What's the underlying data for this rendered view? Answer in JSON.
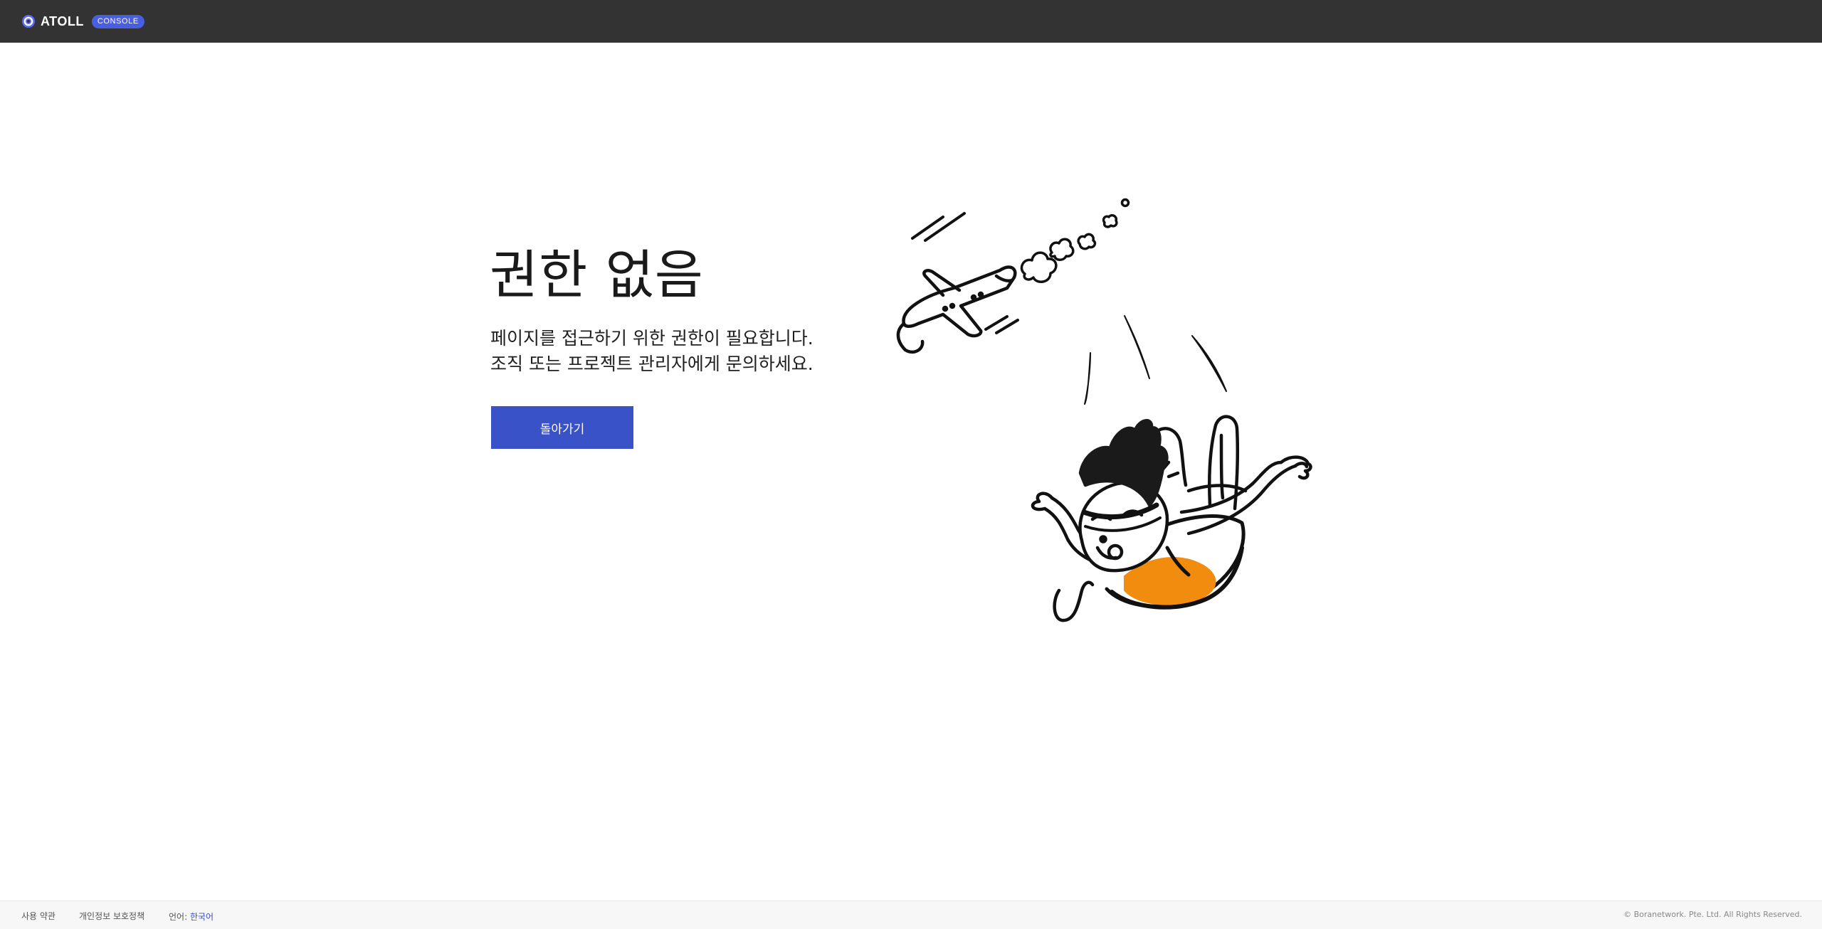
{
  "header": {
    "logo_text": "ATOLL",
    "badge": "CONSOLE",
    "brand_color": "#4a5fe0"
  },
  "main": {
    "title": "권한 없음",
    "description_line1": "페이지를 접근하기 위한 권한이 필요합니다.",
    "description_line2": "조직 또는 프로젝트 관리자에게 문의하세요.",
    "back_button_label": "돌아가기",
    "button_color": "#3a52c8",
    "illustration_accent": "#f18c0e"
  },
  "footer": {
    "terms_label": "사용 약관",
    "privacy_label": "개인정보 보호정책",
    "language_label": "언어:",
    "language_value": "한국어",
    "copyright": "© Boranetwork. Pte. Ltd. All Rights Reserved."
  }
}
